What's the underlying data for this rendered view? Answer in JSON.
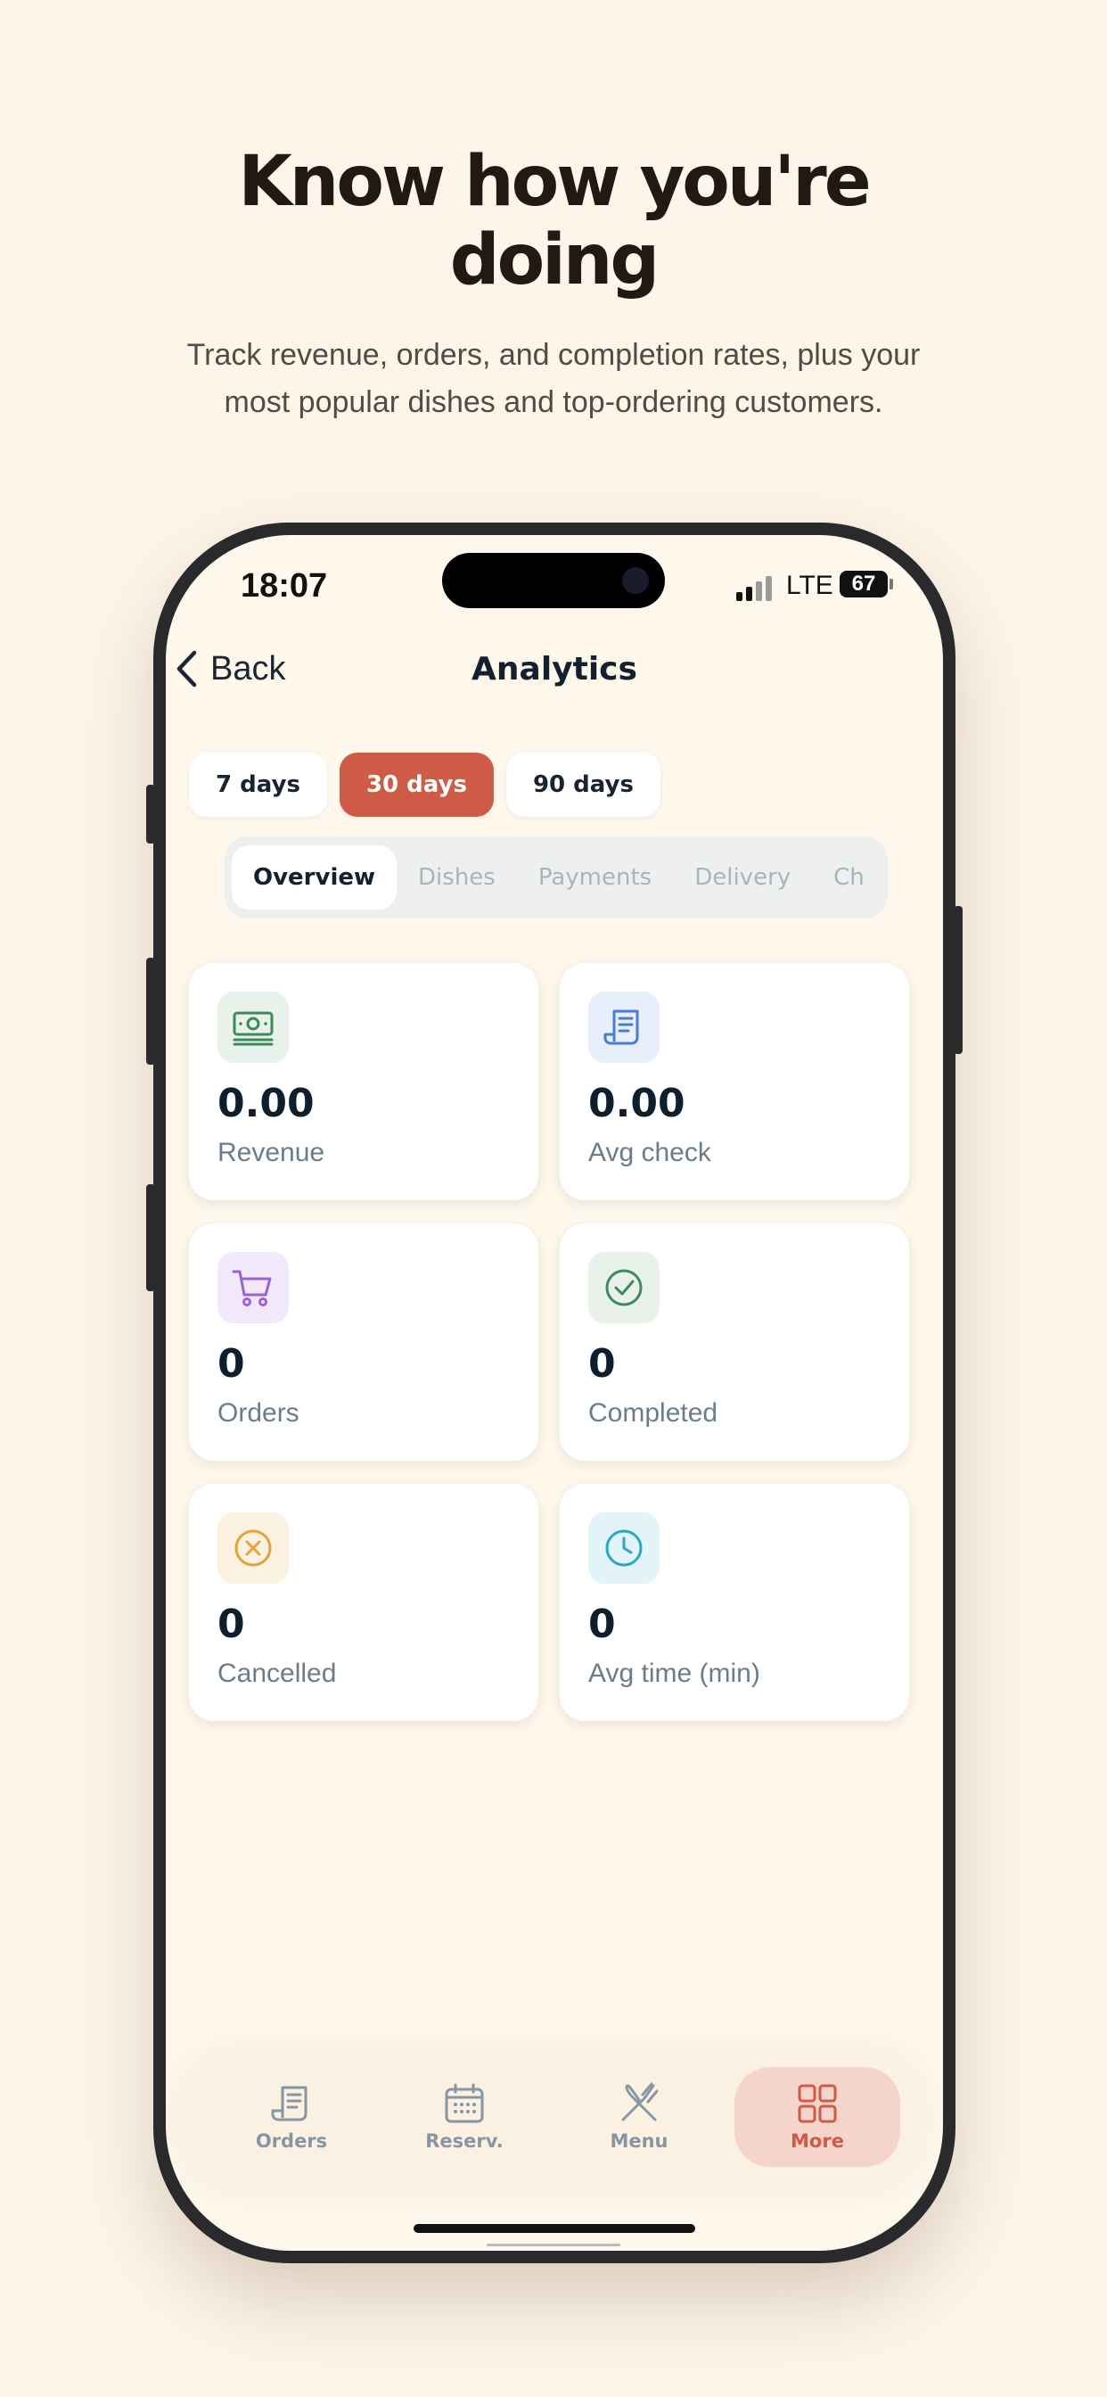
{
  "promo": {
    "title_line1": "Know how you're",
    "title_line2": "doing",
    "subtitle": "Track revenue, orders, and completion rates, plus your most popular dishes and top-ordering customers."
  },
  "status_bar": {
    "time": "18:07",
    "network": "LTE",
    "battery": "67"
  },
  "header": {
    "back_label": "Back",
    "title": "Analytics"
  },
  "periods": [
    {
      "label": "7 days",
      "active": false
    },
    {
      "label": "30 days",
      "active": true
    },
    {
      "label": "90 days",
      "active": false
    }
  ],
  "tabs": [
    {
      "label": "Overview",
      "active": true
    },
    {
      "label": "Dishes",
      "active": false
    },
    {
      "label": "Payments",
      "active": false
    },
    {
      "label": "Delivery",
      "active": false
    },
    {
      "label": "Ch",
      "active": false
    }
  ],
  "stats": [
    {
      "value": "0.00",
      "label": "Revenue",
      "icon": "cash-icon",
      "icon_color": "#3f8a5c",
      "icon_bg": "#e8f1ea"
    },
    {
      "value": "0.00",
      "label": "Avg check",
      "icon": "receipt-icon",
      "icon_color": "#4a7fd0",
      "icon_bg": "#e8effa"
    },
    {
      "value": "0",
      "label": "Orders",
      "icon": "cart-icon",
      "icon_color": "#9a62d8",
      "icon_bg": "#f1e9fa"
    },
    {
      "value": "0",
      "label": "Completed",
      "icon": "check-circle-icon",
      "icon_color": "#3f8a5c",
      "icon_bg": "#e8f1ea"
    },
    {
      "value": "0",
      "label": "Cancelled",
      "icon": "x-circle-icon",
      "icon_color": "#e3a23a",
      "icon_bg": "#fbf1e1"
    },
    {
      "value": "0",
      "label": "Avg time (min)",
      "icon": "clock-icon",
      "icon_color": "#2aa6c7",
      "icon_bg": "#e2f4f8"
    }
  ],
  "tabbar": [
    {
      "label": "Orders",
      "icon": "receipt-icon",
      "active": false
    },
    {
      "label": "Reserv.",
      "icon": "calendar-icon",
      "active": false
    },
    {
      "label": "Menu",
      "icon": "utensils-icon",
      "active": false
    },
    {
      "label": "More",
      "icon": "grid-icon",
      "active": true
    }
  ],
  "colors": {
    "background": "#fdf5e9",
    "accent": "#cf5a45",
    "accent_soft": "#f5d4cc",
    "text_dark": "#14202d",
    "text_muted": "#6b7c8a"
  }
}
